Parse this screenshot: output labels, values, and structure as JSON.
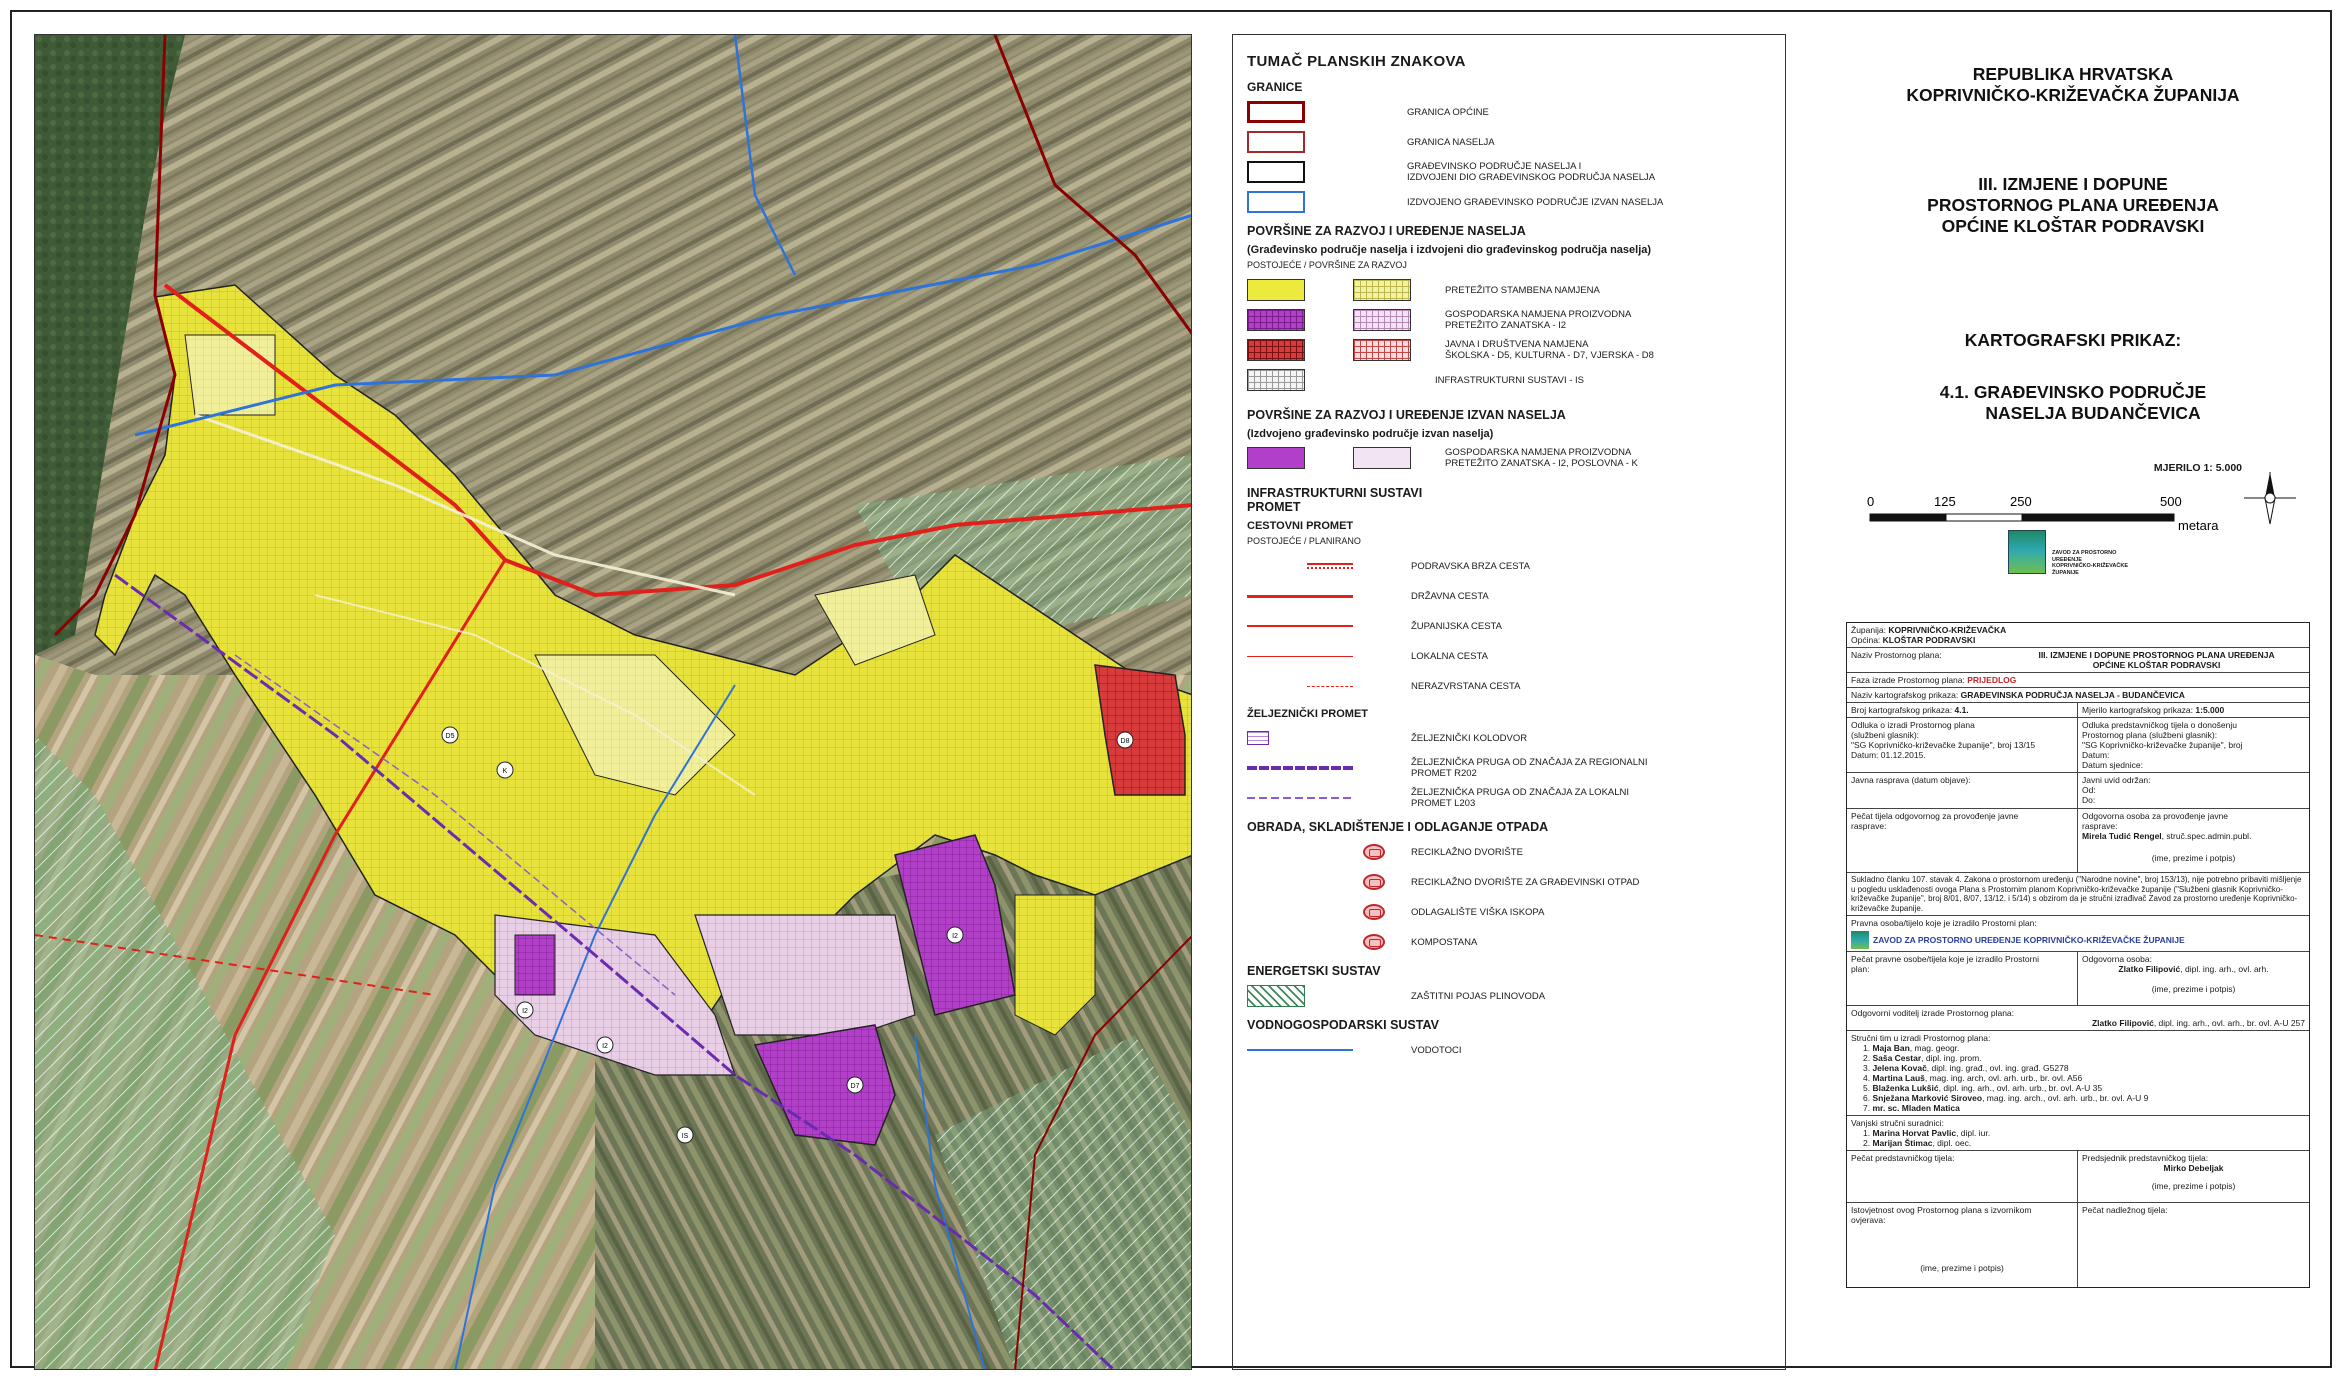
{
  "legend": {
    "title": "TUMAČ PLANSKIH ZNAKOVA",
    "granice": {
      "heading": "GRANICE",
      "items": [
        {
          "label": "GRANICA OPĆINE"
        },
        {
          "label": "GRANICA NASELJA"
        },
        {
          "label": "GRAĐEVINSKO PODRUČJE NASELJA I\nIZDVOJENI DIO GRAĐEVINSKOG PODRUČJA NASELJA"
        },
        {
          "label": "IZDVOJENO GRAĐEVINSKO PODRUČJE IZVAN NASELJA"
        }
      ]
    },
    "razvoj_naselja": {
      "heading": "POVRŠINE ZA RAZVOJ I UREĐENJE NASELJA",
      "subheading": "(Građevinsko područje naselja i izdvojeni dio građevinskog područja naselja)",
      "note": "POSTOJEĆE / POVRŠINE ZA RAZVOJ",
      "items": [
        {
          "label": "PRETEŽITO STAMBENA NAMJENA"
        },
        {
          "label": "GOSPODARSKA NAMJENA PROIZVODNA\nPRETEŽITO ZANATSKA - I2"
        },
        {
          "label": "JAVNA I DRUŠTVENA NAMJENA\nŠKOLSKA - D5, KULTURNA - D7, VJERSKA - D8"
        },
        {
          "label": "INFRASTRUKTURNI SUSTAVI - IS"
        }
      ]
    },
    "razvoj_izvan": {
      "heading": "POVRŠINE ZA RAZVOJ I UREĐENJE IZVAN NASELJA",
      "subheading": "(Izdvojeno građevinsko područje izvan naselja)",
      "items": [
        {
          "label": "GOSPODARSKA NAMJENA PROIZVODNA\nPRETEŽITO ZANATSKA - I2, POSLOVNA - K"
        }
      ]
    },
    "infrastruktura": {
      "heading": "INFRASTRUKTURNI SUSTAVI\nPROMET",
      "cestovni": "CESTOVNI PROMET",
      "note": "POSTOJEĆE / PLANIRANO",
      "items": [
        {
          "label": "PODRAVSKA BRZA CESTA"
        },
        {
          "label": "DRŽAVNA CESTA"
        },
        {
          "label": "ŽUPANIJSKA CESTA"
        },
        {
          "label": "LOKALNA CESTA"
        },
        {
          "label": "NERAZVRSTANA CESTA"
        }
      ],
      "zeljeznicki": "ŽELJEZNIČKI PROMET",
      "rail_items": [
        {
          "label": "ŽELJEZNIČKI KOLODVOR"
        },
        {
          "label": "ŽELJEZNIČKA PRUGA OD ZNAČAJA ZA REGIONALNI\nPROMET R202"
        },
        {
          "label": "ŽELJEZNIČKA PRUGA OD ZNAČAJA ZA LOKALNI\nPROMET L203"
        }
      ]
    },
    "otpad": {
      "heading": "OBRADA, SKLADIŠTENJE I ODLAGANJE OTPADA",
      "items": [
        {
          "label": "RECIKLAŽNO DVORIŠTE"
        },
        {
          "label": "RECIKLAŽNO DVORIŠTE ZA GRAĐEVINSKI OTPAD"
        },
        {
          "label": "ODLAGALIŠTE VIŠKA ISKOPA"
        },
        {
          "label": "KOMPOSTANA"
        }
      ]
    },
    "energetski": {
      "heading": "ENERGETSKI SUSTAV",
      "items": [
        {
          "label": "ZAŠTITNI POJAS PLINOVODA"
        }
      ]
    },
    "vodni": {
      "heading": "VODNOGOSPODARSKI SUSTAV",
      "items": [
        {
          "label": "VODOTOCI"
        }
      ]
    }
  },
  "title_block": {
    "republika": "REPUBLIKA HRVATSKA",
    "zupanija": "KOPRIVNIČKO-KRIŽEVAČKA ŽUPANIJA",
    "plan_line1": "III. IZMJENE I DOPUNE",
    "plan_line2": "PROSTORNOG PLANA UREĐENJA",
    "plan_line3": "OPĆINE KLOŠTAR PODRAVSKI",
    "kart_heading": "KARTOGRAFSKI PRIKAZ:",
    "kart_line1": "4.1. GRAĐEVINSKO PODRUČJE",
    "kart_line2": "NASELJA BUDANČEVICA",
    "scale_label": "MJERILO 1: 5.000",
    "scale_ticks": [
      "0",
      "125",
      "250",
      "500"
    ],
    "scale_unit": "metara",
    "logo_text": "ZAVOD ZA PROSTORNO UREĐENJE\nKOPRIVNIČKO-KRIŽEVAČKE ŽUPANIJE"
  },
  "info": {
    "zupanija_label": "Županija:",
    "zupanija_value": "KOPRIVNIČKO-KRIŽEVAČKA",
    "opcina_label": "Općina:",
    "opcina_value": "KLOŠTAR PODRAVSKI",
    "naziv_plana_label": "Naziv Prostornog plana:",
    "naziv_plana_value": "III. IZMJENE I DOPUNE PROSTORNOG PLANA UREĐENJA\nOPĆINE KLOŠTAR PODRAVSKI",
    "faza_label": "Faza izrade Prostornog plana:",
    "faza_value": "PRIJEDLOG",
    "naziv_kart_label": "Naziv kartografskog prikaza:",
    "naziv_kart_value": "GRAĐEVINSKA PODRUČJA NASELJA - BUDANČEVICA",
    "broj_label": "Broj kartografskog prikaza:",
    "broj_value": "4.1.",
    "mjerilo_label": "Mjerilo kartografskog prikaza:",
    "mjerilo_value": "1:5.000",
    "odluka_left": "Odluka o izradi Prostornog plana\n(službeni glasnik):\n\"SG Koprivničko-križevačke županije\", broj 13/15\nDatum: 01.12.2015.",
    "odluka_right": "Odluka predstavničkog tijela o donošenju\nProstornog plana (službeni glasnik):\n\"SG Koprivničko-križevačke županije\", broj\nDatum:\nDatum sjednice:",
    "javna_left": "Javna rasprava (datum objave):",
    "javna_right": "Javni uvid održan:\nOd:\nDo:",
    "pecat_left": "Pečat tijela odgovornog za provođenje javne\nrasprave:",
    "odg_osoba_label": "Odgovorna osoba za provođenje javne\nrasprave:",
    "odg_osoba_value": "Mirela Tudić Rengel",
    "odg_osoba_suffix": ", struč.spec.admin.publ.",
    "ime_prezime": "(ime, prezime i potpis)",
    "sukladno": "Sukladno članku 107. stavak 4. Zakona o prostornom uređenju (\"Narodne novine\", broj 153/13), nije potrebno pribaviti mišljenje u pogledu usklađenosti ovoga Plana s Prostornim planom Koprivničko-križevačke županije (\"Službeni glasnik Koprivničko-križevačke županije\", broj 8/01, 8/07, 13/12. i 5/14) s obzirom da je stručni izrađivač Zavod za prostorno uređenje Koprivničko-križevačke županije.",
    "pravna_osoba_label": "Pravna osoba/tijelo koje je izradilo Prostorni plan:",
    "pravna_osoba_value": "ZAVOD ZA PROSTORNO UREĐENJE KOPRIVNIČKO-KRIŽEVAČKE ŽUPANIJE",
    "pecat_pravne_label": "Pečat pravne osobe/tijela koje je izradilo Prostorni\nplan:",
    "odgovorna_osoba_label": "Odgovorna osoba:",
    "odgovorna_osoba_value": "Zlatko Filipović",
    "odgovorna_osoba_suffix": ", dipl. ing. arh., ovl. arh.",
    "voditelj_label": "Odgovorni voditelj izrade Prostornog plana:",
    "voditelj_value": "Zlatko Filipović",
    "voditelj_suffix": ", dipl. ing. arh., ovl. arh., br. ovl. A-U 257",
    "strucni_tim_label": "Stručni tim u izradi Prostornog plana:",
    "strucni_tim": [
      {
        "no": "1.",
        "name": "Maja Ban",
        "rest": ", mag. geogr."
      },
      {
        "no": "2.",
        "name": "Saša Cestar",
        "rest": ", dipl. ing. prom."
      },
      {
        "no": "3.",
        "name": "Jelena Kovač",
        "rest": ", dipl. ing. građ., ovl. ing. građ. G5278"
      },
      {
        "no": "4.",
        "name": "Martina Lauš",
        "rest": ", mag. ing. arch, ovl. arh. urb., br. ovl. A56"
      },
      {
        "no": "5.",
        "name": "Blaženka Lukšić",
        "rest": ", dipl. ing. arh., ovl. arh. urb., br. ovl. A-U 35"
      },
      {
        "no": "6.",
        "name": "Snježana Marković Siroveo",
        "rest": ", mag. ing. arch., ovl. arh. urb., br. ovl. A-U 9"
      },
      {
        "no": "7.",
        "name": "mr. sc. Mladen Matica",
        "rest": ""
      }
    ],
    "vanjski_label": "Vanjski stručni suradnici:",
    "vanjski": [
      {
        "no": "1.",
        "name": "Marina Horvat Pavlic",
        "rest": ", dipl. iur."
      },
      {
        "no": "2.",
        "name": "Marijan Štimac",
        "rest": ", dipl. oec."
      }
    ],
    "pecat_pred_label": "Pečat predstavničkog tijela:",
    "predsjednik_label": "Predsjednik predstavničkog tijela:",
    "predsjednik_value": "Mirko Debeljak",
    "istovjetnost_label": "Istovjetnost ovog Prostornog plana s izvornikom\novjerava:",
    "pecat_nadl_label": "Pečat nadležnog tijela:"
  },
  "map": {
    "zone_labels": [
      "I2",
      "I2",
      "I2",
      "D5",
      "D8",
      "IS",
      "D7",
      "K"
    ]
  }
}
